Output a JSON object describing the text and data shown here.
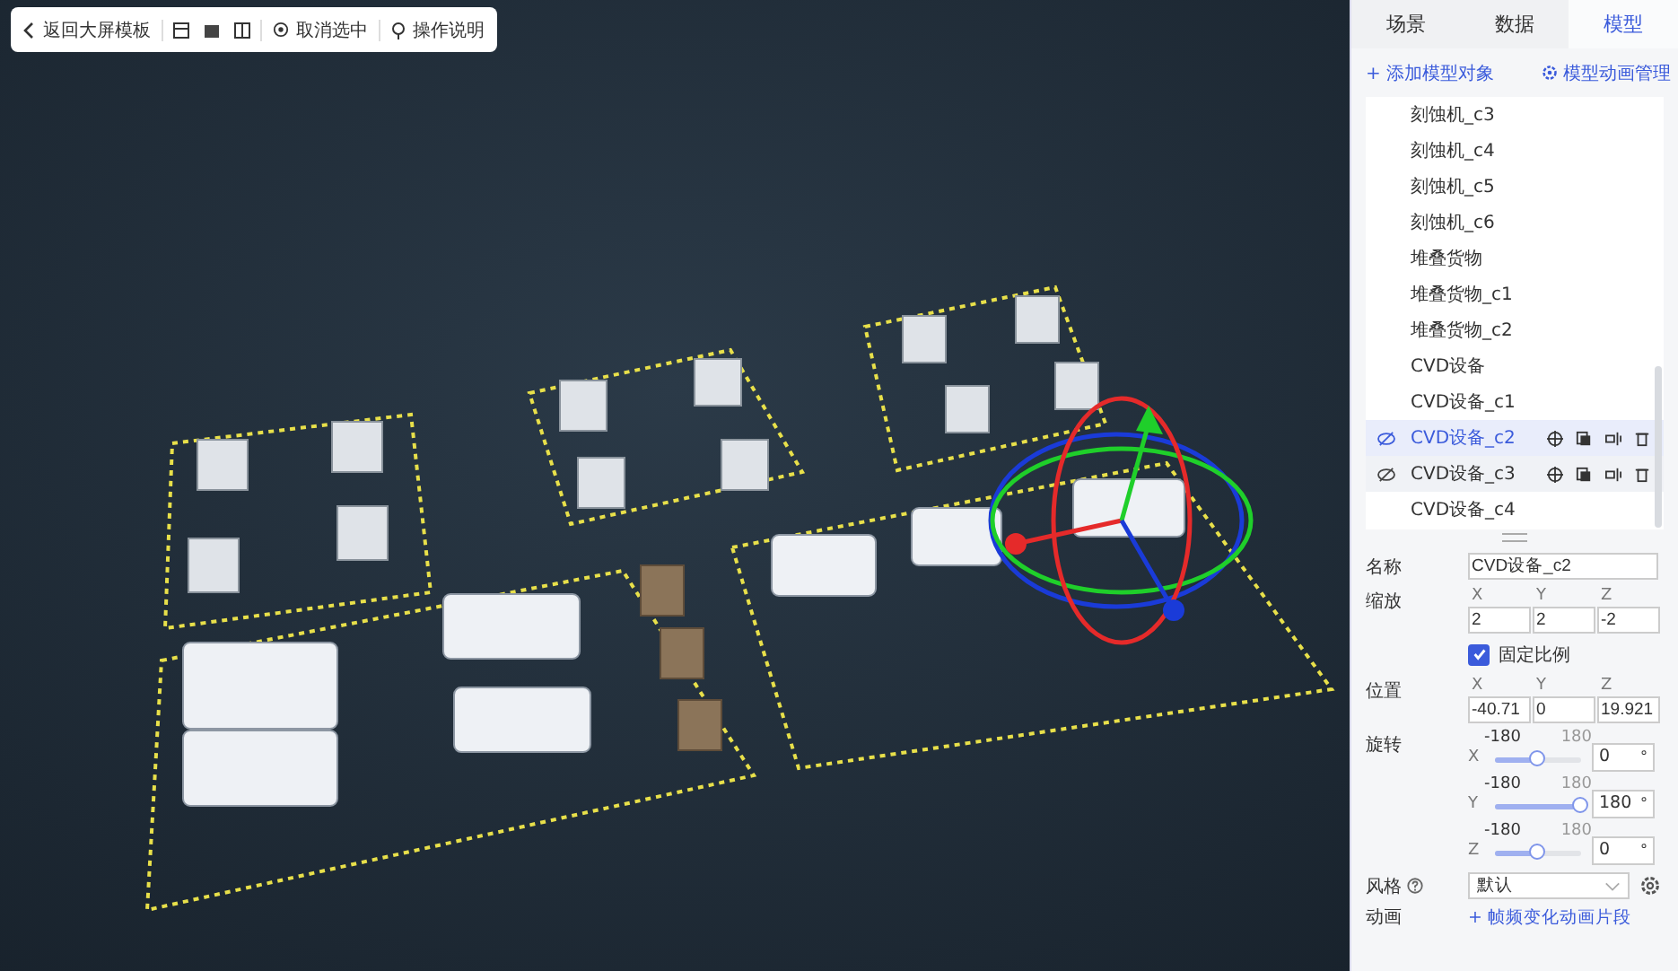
{
  "toolbar": {
    "back": "返回大屏模板",
    "cancel_select": "取消选中",
    "help": "操作说明"
  },
  "tabs": [
    {
      "label": "场景",
      "selected": false
    },
    {
      "label": "数据",
      "selected": false
    },
    {
      "label": "模型",
      "selected": true
    }
  ],
  "actions": {
    "add": "+ 添加模型对象",
    "anim": "模型动画管理"
  },
  "objects": [
    {
      "name": "刻蚀机_c3",
      "selected": false,
      "hovered": false
    },
    {
      "name": "刻蚀机_c4",
      "selected": false,
      "hovered": false
    },
    {
      "name": "刻蚀机_c5",
      "selected": false,
      "hovered": false
    },
    {
      "name": "刻蚀机_c6",
      "selected": false,
      "hovered": false
    },
    {
      "name": "堆叠货物",
      "selected": false,
      "hovered": false
    },
    {
      "name": "堆叠货物_c1",
      "selected": false,
      "hovered": false
    },
    {
      "name": "堆叠货物_c2",
      "selected": false,
      "hovered": false
    },
    {
      "name": "CVD设备",
      "selected": false,
      "hovered": false
    },
    {
      "name": "CVD设备_c1",
      "selected": false,
      "hovered": false
    },
    {
      "name": "CVD设备_c2",
      "selected": true,
      "hovered": false
    },
    {
      "name": "CVD设备_c3",
      "selected": false,
      "hovered": true
    },
    {
      "name": "CVD设备_c4",
      "selected": false,
      "hovered": false
    }
  ],
  "properties": {
    "name": {
      "label": "名称",
      "value": "CVD设备_c2"
    },
    "scale": {
      "label": "缩放",
      "axes": [
        {
          "axis": "X",
          "value": "2"
        },
        {
          "axis": "Y",
          "value": "2"
        },
        {
          "axis": "Z",
          "value": "-2"
        }
      ]
    },
    "lock_ratio": {
      "label": "固定比例",
      "checked": true
    },
    "position": {
      "label": "位置",
      "axes": [
        {
          "axis": "X",
          "value": "-40.71"
        },
        {
          "axis": "Y",
          "value": "0"
        },
        {
          "axis": "Z",
          "value": "19.921"
        }
      ]
    },
    "rotation": {
      "label": "旋转",
      "axes": [
        {
          "axis": "X",
          "min": "-180",
          "max": "180",
          "level": 0.5,
          "value": "0",
          "unit": "°"
        },
        {
          "axis": "Y",
          "min": "-180",
          "max": "180",
          "level": 1,
          "value": "180",
          "unit": "°"
        },
        {
          "axis": "Z",
          "min": "-180",
          "max": "180",
          "level": 0.5,
          "value": "0",
          "unit": "°"
        }
      ]
    },
    "style": {
      "label": "风格",
      "value": "默认"
    },
    "animation": {
      "label": "动画",
      "link": "+ 帧频变化动画片段"
    }
  }
}
